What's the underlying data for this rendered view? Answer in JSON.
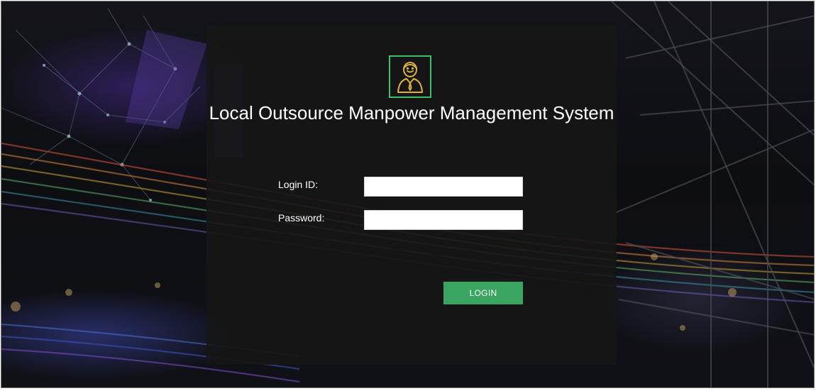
{
  "app": {
    "title": "Local Outsource Manpower Management System"
  },
  "login_form": {
    "login_id_label": "Login ID:",
    "login_id_value": "",
    "password_label": "Password:",
    "password_value": "",
    "login_button_label": "LOGIN"
  },
  "icons": {
    "logo": "user-avatar-icon"
  },
  "colors": {
    "accent": "#3aa560",
    "logo_border": "#3fbf6a",
    "logo_icon": "#e0b23a",
    "panel_bg": "#161616",
    "text": "#ffffff"
  }
}
